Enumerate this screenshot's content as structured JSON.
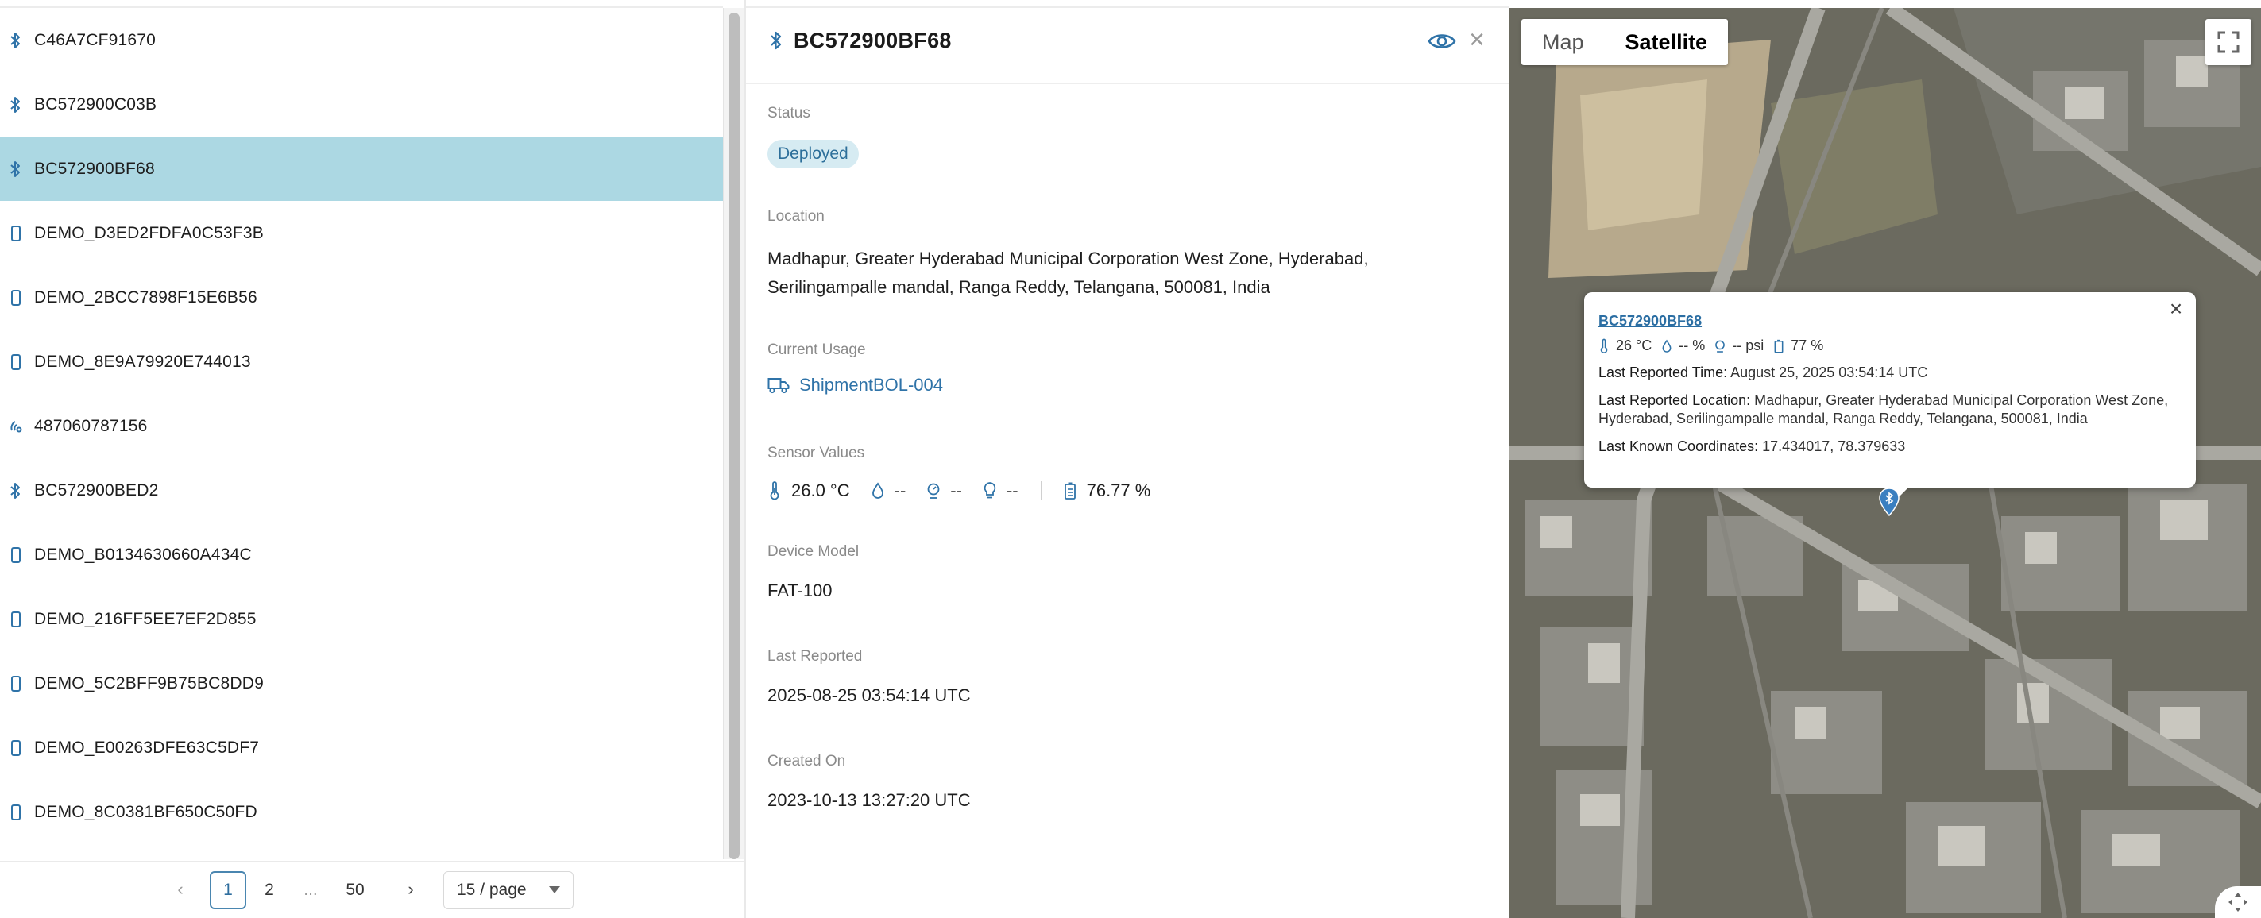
{
  "device_list": {
    "items": [
      {
        "name": "C46A7CF91670",
        "icon": "bluetooth-icon",
        "selected": false
      },
      {
        "name": "BC572900C03B",
        "icon": "bluetooth-icon",
        "selected": false
      },
      {
        "name": "BC572900BF68",
        "icon": "bluetooth-icon",
        "selected": true
      },
      {
        "name": "DEMO_D3ED2FDFA0C53F3B",
        "icon": "mobile-device-icon",
        "selected": false
      },
      {
        "name": "DEMO_2BCC7898F15E6B56",
        "icon": "mobile-device-icon",
        "selected": false
      },
      {
        "name": "DEMO_8E9A79920E744013",
        "icon": "mobile-device-icon",
        "selected": false
      },
      {
        "name": "487060787156",
        "icon": "signal-tracker-icon",
        "selected": false
      },
      {
        "name": "BC572900BED2",
        "icon": "bluetooth-icon",
        "selected": false
      },
      {
        "name": "DEMO_B0134630660A434C",
        "icon": "mobile-device-icon",
        "selected": false
      },
      {
        "name": "DEMO_216FF5EE7EF2D855",
        "icon": "mobile-device-icon",
        "selected": false
      },
      {
        "name": "DEMO_5C2BFF9B75BC8DD9",
        "icon": "mobile-device-icon",
        "selected": false
      },
      {
        "name": "DEMO_E00263DFE63C5DF7",
        "icon": "mobile-device-icon",
        "selected": false
      },
      {
        "name": "DEMO_8C0381BF650C50FD",
        "icon": "mobile-device-icon",
        "selected": false
      }
    ]
  },
  "pagination": {
    "prev": "‹",
    "pages": [
      "1",
      "2"
    ],
    "ellipsis": "...",
    "last": "50",
    "next": "›",
    "page_size": "15 / page",
    "current": "1"
  },
  "detail": {
    "title": "BC572900BF68",
    "status_label": "Status",
    "status_value": "Deployed",
    "location_label": "Location",
    "location_line1": "Madhapur, Greater Hyderabad Municipal Corporation West Zone, Hyderabad,",
    "location_line2": "Serilingampalle mandal, Ranga Reddy, Telangana, 500081, India",
    "usage_label": "Current Usage",
    "usage_value": "ShipmentBOL-004",
    "sensor_label": "Sensor Values",
    "sensors": {
      "temperature": "26.0 °C",
      "humidity": "--",
      "pressure": "--",
      "light": "--",
      "battery": "76.77 %"
    },
    "model_label": "Device Model",
    "model_value": "FAT-100",
    "last_reported_label": "Last Reported",
    "last_reported_value": "2025-08-25 03:54:14 UTC",
    "created_label": "Created On",
    "created_value": "2023-10-13 13:27:20 UTC"
  },
  "map": {
    "toggle_map": "Map",
    "toggle_satellite": "Satellite",
    "active_mode": "Satellite",
    "info": {
      "title": "BC572900BF68",
      "temp": "26 °C",
      "humidity": "-- %",
      "pressure": "-- psi",
      "battery": "77 %",
      "time_label": "Last Reported Time:",
      "time_value": "August 25, 2025 03:54:14 UTC",
      "location_label": "Last Reported Location:",
      "location_value": "Madhapur, Greater Hyderabad Municipal Corporation West Zone, Hyderabad, Serilingampalle mandal, Ranga Reddy, Telangana, 500081, India",
      "coords_label": "Last Known Coordinates:",
      "coords_value": "17.434017, 78.379633"
    }
  },
  "colors": {
    "accent": "#2f73a8",
    "selected_row": "#acd8e3",
    "badge_bg": "#d6ebf2"
  }
}
